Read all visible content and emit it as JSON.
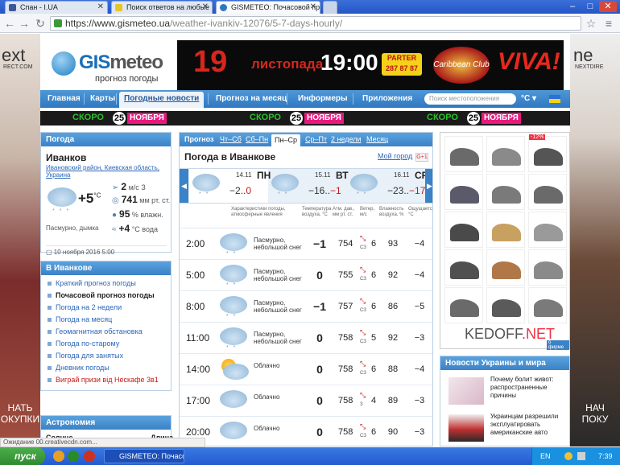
{
  "browser": {
    "tabs": [
      {
        "title": "Спан - I.UA",
        "color": "#3b5998"
      },
      {
        "title": "Поиск ответов на любые в",
        "color": "#5aa02c"
      },
      {
        "title": "GISMETEO: Почасовой прог",
        "color": "#2f78c0"
      }
    ],
    "url_domain": "https://www.gismeteo.ua",
    "url_path": "/weather-ivankiv-12076/5-7-days-hourly/"
  },
  "side_ads": {
    "left": {
      "brand": "ext",
      "sub": "RECT.COM",
      "cta_line1": "НАТЬ",
      "cta_line2": "ОКУПКИ"
    },
    "right": {
      "brand": "ne",
      "sub": "NEXTDIRE",
      "cta_line1": "НАЧ",
      "cta_line2": "ПОКУ"
    }
  },
  "logo": {
    "brand_main": "GIS",
    "brand_rest": "meteo",
    "subtitle": "прогноз погоды"
  },
  "banner": {
    "day": "19",
    "month": "листопада",
    "time": "19:00",
    "partner": "PARTER\n287 87 87",
    "club": "Caribbean Club",
    "viva": "VIVA!"
  },
  "menu": {
    "items": [
      "Главная",
      "Карты",
      "Погодные новости",
      "Прогноз на месяц",
      "Информеры",
      "Приложения"
    ],
    "search_placeholder": "Поиск местоположения",
    "unit": "°C"
  },
  "promo": {
    "label": "СКОРО",
    "day": "25",
    "month": "НОЯБРЯ"
  },
  "now": {
    "title": "Погода",
    "city": "Иванков",
    "region": "Ивановский район, Киевская область, Украина",
    "temp": "+5",
    "temp_unit": "°C",
    "desc": "Пасмурно, дымка",
    "wind_value": "2",
    "wind_unit": "м/с",
    "wind_dir": "З",
    "pressure_value": "741",
    "pressure_unit": "мм рт. ст.",
    "humidity_value": "95",
    "humidity_unit": "% влажн.",
    "water_value": "+4",
    "water_unit": "°C вода",
    "updated": "10 ноября 2016 5:00"
  },
  "links": {
    "title": "В Иванкове",
    "items": [
      "Краткий прогноз погоды",
      "Почасовой прогноз погоды",
      "Погода на 2 недели",
      "Погода на месяц",
      "Геомагнитная обстановка",
      "Погода по-старому",
      "Погода для занятых",
      "Дневник погоды",
      "Виграй призи від Нескафе 3в1"
    ]
  },
  "astro": {
    "title": "Астрономия",
    "sun": "Солнце",
    "length": "Длина"
  },
  "forecast": {
    "tabs": [
      "Прогноз",
      "Чт–Сб",
      "Сб–Пн",
      "Пн–Ср",
      "Ср–Пт",
      "2 недели",
      "Месяц"
    ],
    "title": "Погода в Иванкове",
    "my_region": "Мой город",
    "gplus": "G+1",
    "days": [
      {
        "date": "14.11",
        "dow": "ПН",
        "tmin": "−2",
        "tmax": "0"
      },
      {
        "date": "15.11",
        "dow": "ВТ",
        "tmin": "−16",
        "tmax": "−1"
      },
      {
        "date": "16.11",
        "dow": "СР",
        "tmin": "−23",
        "tmax": "−17"
      }
    ],
    "cols": {
      "desc": "Характеристики погоды, атмосферные явления",
      "temp": "Температура воздуха, °C",
      "press": "Атм. дав., мм рт. ст.",
      "wind": "Ветер, м/с",
      "hum": "Влажность воздуха, %",
      "feel": "Ощущается, °C"
    },
    "rows": [
      {
        "time": "2:00",
        "desc": "Пасмурно, небольшой снег",
        "temp": "−1",
        "press": "754",
        "wind_dir": "СЗ",
        "wind": "6",
        "hum": "93",
        "feel": "−4",
        "icon": "cloud-snow"
      },
      {
        "time": "5:00",
        "desc": "Пасмурно, небольшой снег",
        "temp": "0",
        "press": "755",
        "wind_dir": "СЗ",
        "wind": "6",
        "hum": "92",
        "feel": "−4",
        "icon": "cloud-snow"
      },
      {
        "time": "8:00",
        "desc": "Пасмурно, небольшой снег",
        "temp": "−1",
        "press": "757",
        "wind_dir": "СЗ",
        "wind": "6",
        "hum": "86",
        "feel": "−5",
        "icon": "cloud-snow"
      },
      {
        "time": "11:00",
        "desc": "Пасмурно, небольшой снег",
        "temp": "0",
        "press": "758",
        "wind_dir": "СЗ",
        "wind": "5",
        "hum": "92",
        "feel": "−3",
        "icon": "cloud-snow"
      },
      {
        "time": "14:00",
        "desc": "Облачно",
        "temp": "0",
        "press": "758",
        "wind_dir": "СЗ",
        "wind": "6",
        "hum": "88",
        "feel": "−4",
        "icon": "sun-cloud"
      },
      {
        "time": "17:00",
        "desc": "Облачно",
        "temp": "0",
        "press": "758",
        "wind_dir": "З",
        "wind": "4",
        "hum": "89",
        "feel": "−3",
        "icon": "cloud"
      },
      {
        "time": "20:00",
        "desc": "Облачно",
        "temp": "0",
        "press": "758",
        "wind_dir": "СЗ",
        "wind": "6",
        "hum": "90",
        "feel": "−3",
        "icon": "cloud"
      }
    ]
  },
  "shop": {
    "brand_a": "KEDOFF",
    "brand_b": ".NET",
    "sale": "-12%",
    "firms": "о фирме",
    "shoe_colors": [
      "#6a6a6a",
      "#8a8a8a",
      "#555",
      "#5a5a6a",
      "#7a7a7a",
      "#6a6a6a",
      "#4a4a4a",
      "#c8a060",
      "#9a9a9a",
      "#505050",
      "#b07848",
      "#8a8a8a",
      "#6a6a6a",
      "#5a5a5a",
      "#7a7a7a"
    ]
  },
  "news": {
    "title": "Новости Украины и мира",
    "items": [
      "Почему болит живот: распространенные причины",
      "Украинцам разрешили эксплуатировать американские авто"
    ]
  },
  "status": "Ожидание 00.creativecdn.com...",
  "taskbar": {
    "start": "пуск",
    "task": "GISMETEO: Почасов...",
    "lang": "EN",
    "clock": "7:39"
  }
}
